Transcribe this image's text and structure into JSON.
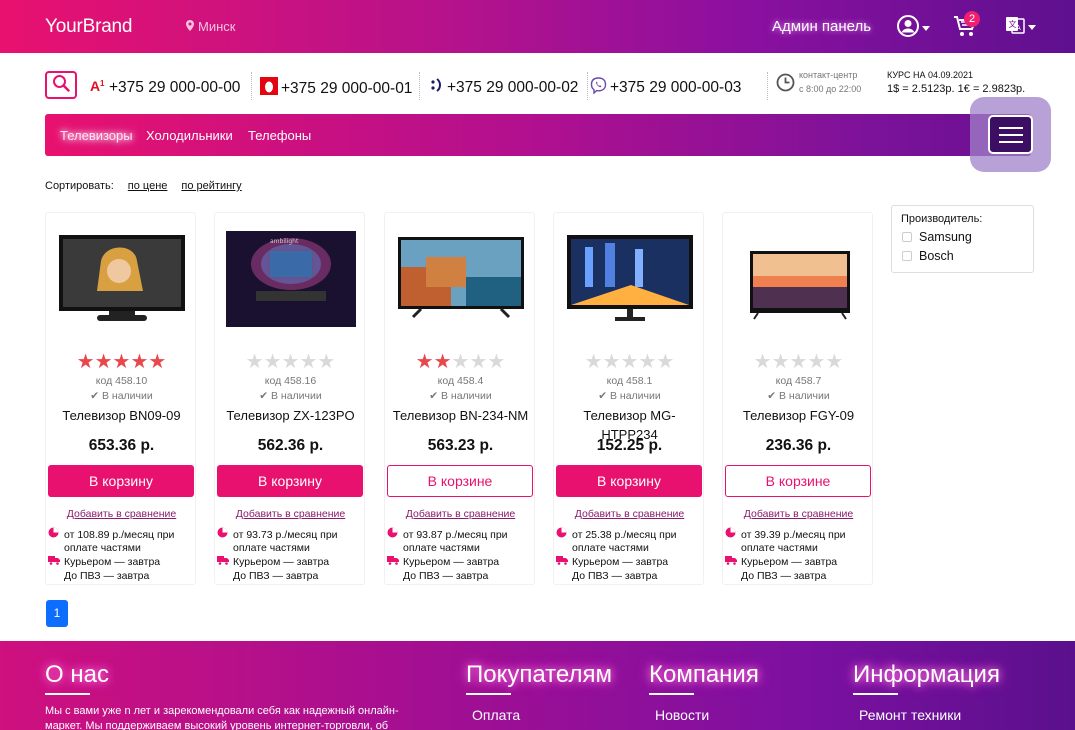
{
  "header": {
    "brand": "YourBrand",
    "city": "Минск",
    "admin": "Админ панель",
    "cart_count": "2"
  },
  "contacts": {
    "phones": [
      {
        "operator": "a1",
        "number": "+375 29 000-00-00"
      },
      {
        "operator": "mts",
        "number": "+375 29 000-00-01"
      },
      {
        "operator": "life",
        "number": "+375 29 000-00-02"
      },
      {
        "operator": "viber",
        "number": "+375 29 000-00-03"
      }
    ],
    "center_title": "контакт-центр",
    "center_hours": "с 8:00 до 22:00",
    "rate_title": "КУРС НА 04.09.2021",
    "rate_values": "1$ = 2.5123р.  1€ = 2.9823р."
  },
  "categories": [
    "Телевизоры",
    "Холодильники",
    "Телефоны"
  ],
  "sort": {
    "label": "Сортировать:",
    "by_price": "по цене",
    "by_rating": "по рейтингу"
  },
  "products": [
    {
      "name": "Телевизор BN09-09",
      "code": "код 458.10",
      "stock": "✔ В наличии",
      "price": "653.36 р.",
      "rating": 5,
      "button": "В корзину",
      "in_cart": false,
      "installment": "от 108.89 р./месяц при",
      "installment2": "оплате частями"
    },
    {
      "name": "Телевизор ZX-123PO",
      "code": "код 458.16",
      "stock": "✔ В наличии",
      "price": "562.36 р.",
      "rating": 0,
      "button": "В корзину",
      "in_cart": false,
      "installment": "от 93.73 р./месяц при",
      "installment2": "оплате частями"
    },
    {
      "name": "Телевизор BN-234-NM",
      "code": "код 458.4",
      "stock": "✔ В наличии",
      "price": "563.23 р.",
      "rating": 2,
      "button": "В корзине",
      "in_cart": true,
      "installment": "от 93.87 р./месяц при",
      "installment2": "оплате частями"
    },
    {
      "name": "Телевизор MG-HTPP234",
      "code": "код 458.1",
      "stock": "✔ В наличии",
      "price": "152.25 р.",
      "rating": 0,
      "button": "В корзину",
      "in_cart": false,
      "installment": "от 25.38 р./месяц при",
      "installment2": "оплате частями"
    },
    {
      "name": "Телевизор FGY-09",
      "code": "код 458.7",
      "stock": "✔ В наличии",
      "price": "236.36 р.",
      "rating": 0,
      "button": "В корзине",
      "in_cart": true,
      "installment": "от 39.39 р./месяц при",
      "installment2": "оплате частями"
    }
  ],
  "product_common": {
    "compare": "Добавить в сравнение",
    "courier": "Курьером — завтра",
    "pickup": "До ПВЗ — завтра"
  },
  "filter": {
    "title": "Производитель:",
    "options": [
      "Samsung",
      "Bosch"
    ]
  },
  "pagination": {
    "current": "1"
  },
  "footer": {
    "about_title": "О нас",
    "about_text": "Мы с вами уже n лет и зарекомендовали себя как надежный онлайн-маркет. Мы поддерживаем высокий уровень интернет-торговли, об",
    "buyers_title": "Покупателям",
    "buyers_link": "Оплата",
    "company_title": "Компания",
    "company_link": "Новости",
    "info_title": "Информация",
    "info_link": "Ремонт техники"
  },
  "colors": {
    "accent": "#e8116f",
    "purple": "#6a1090",
    "star_on": "#e8474c",
    "star_off": "#d9d9d9",
    "page_button": "#0d6efd"
  }
}
